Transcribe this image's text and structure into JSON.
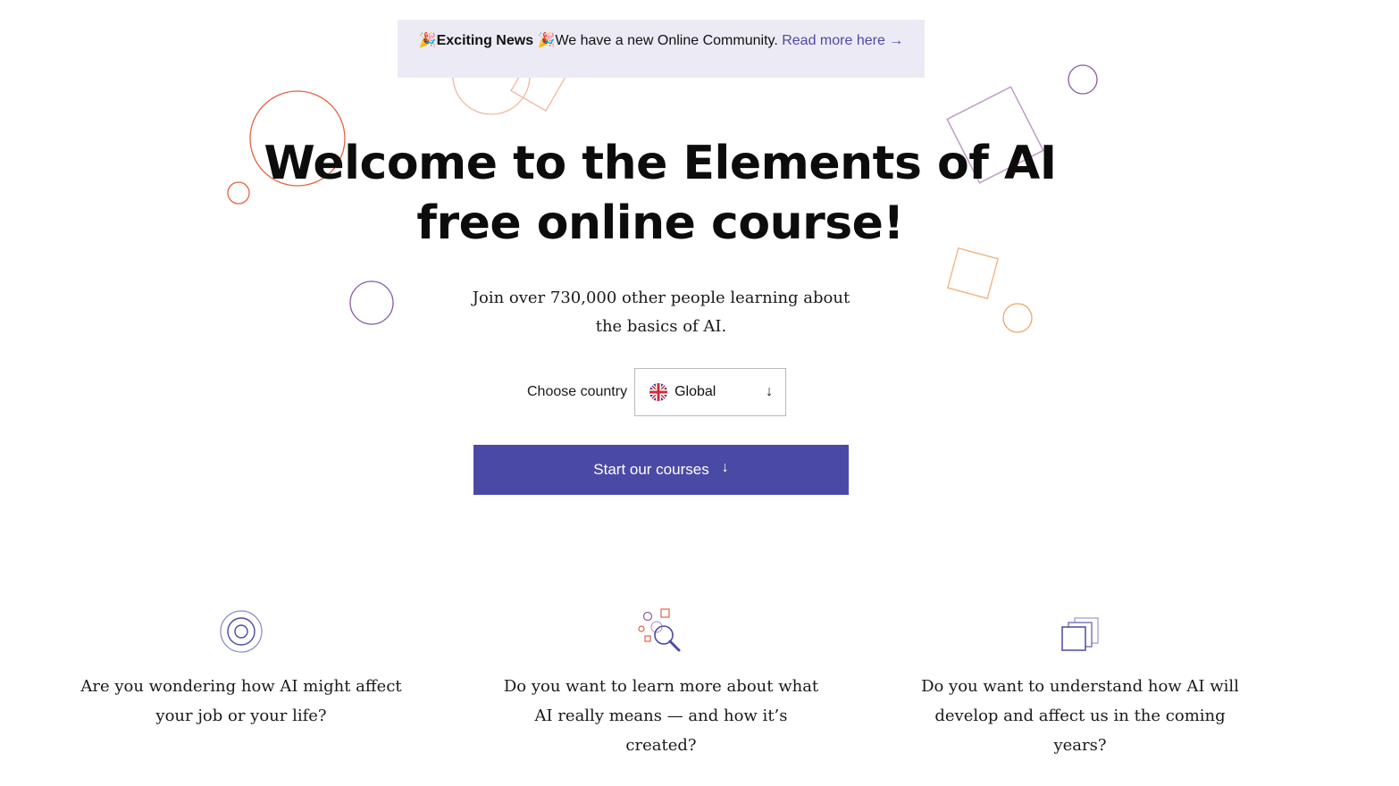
{
  "banner": {
    "emoji": "🎉",
    "title": "Exciting News",
    "message": "We have a new Online Community.",
    "link_label": "Read more here",
    "link_arrow": "→"
  },
  "hero": {
    "title_line1": "Welcome to the Elements of AI",
    "title_line2": "free online course!",
    "subtitle": "Join over 730,000 other people learning about the basics of AI."
  },
  "country": {
    "label": "Choose country",
    "selected": "Global",
    "flag_icon": "uk-flag-icon",
    "arrow": "↓"
  },
  "cta": {
    "label": "Start our courses",
    "arrow": "↓"
  },
  "features": [
    {
      "icon": "target-icon",
      "text": "Are you wondering how AI might affect your job or your life?"
    },
    {
      "icon": "magnifier-icon",
      "text": "Do you want to learn more about what AI really means — and how it’s created?"
    },
    {
      "icon": "layers-icon",
      "text": "Do you want to understand how AI will develop and affect us in the coming years?"
    }
  ],
  "colors": {
    "primary": "#4b49a6",
    "banner_bg": "#ecebf5",
    "decor_red": "#e8613f",
    "decor_orange": "#f0a560",
    "decor_peach": "#f2b79a",
    "decor_purple": "#8a5aa8",
    "decor_lilac": "#c39ac9"
  }
}
